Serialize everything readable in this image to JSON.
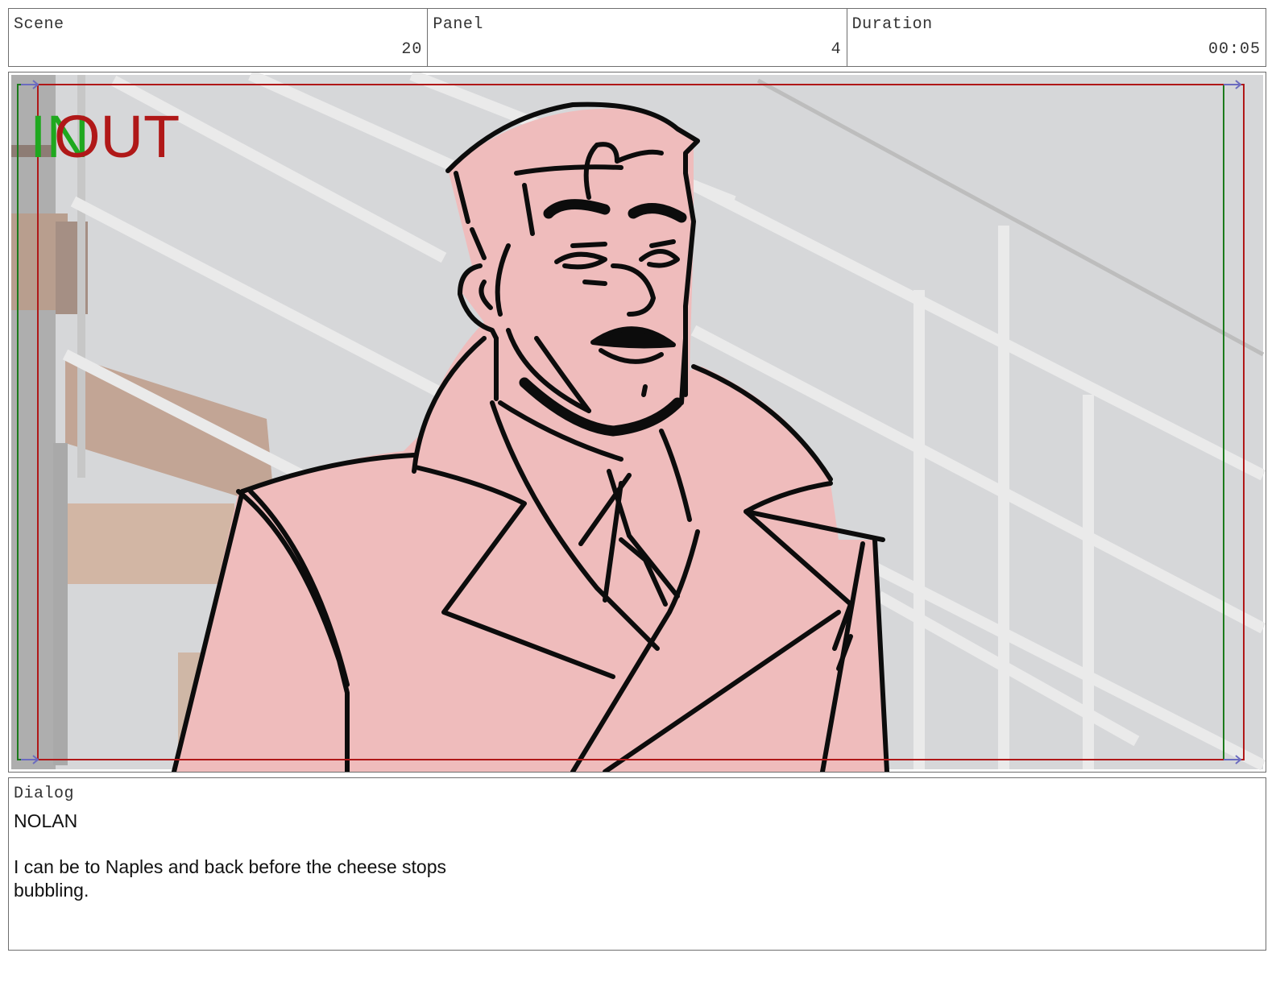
{
  "header": {
    "scene": {
      "label": "Scene",
      "value": "20"
    },
    "panel": {
      "label": "Panel",
      "value": "4"
    },
    "duration": {
      "label": "Duration",
      "value": "00:05"
    }
  },
  "frame": {
    "in_label": "IN",
    "out_label": "OUT",
    "colors": {
      "in": "#1fa81f",
      "out": "#b01818",
      "figure_fill": "#efbcbc",
      "background": "#d6d7d9"
    }
  },
  "dialog": {
    "label": "Dialog",
    "speaker": "NOLAN",
    "line": "I can be to Naples and back before the cheese stops bubbling."
  }
}
